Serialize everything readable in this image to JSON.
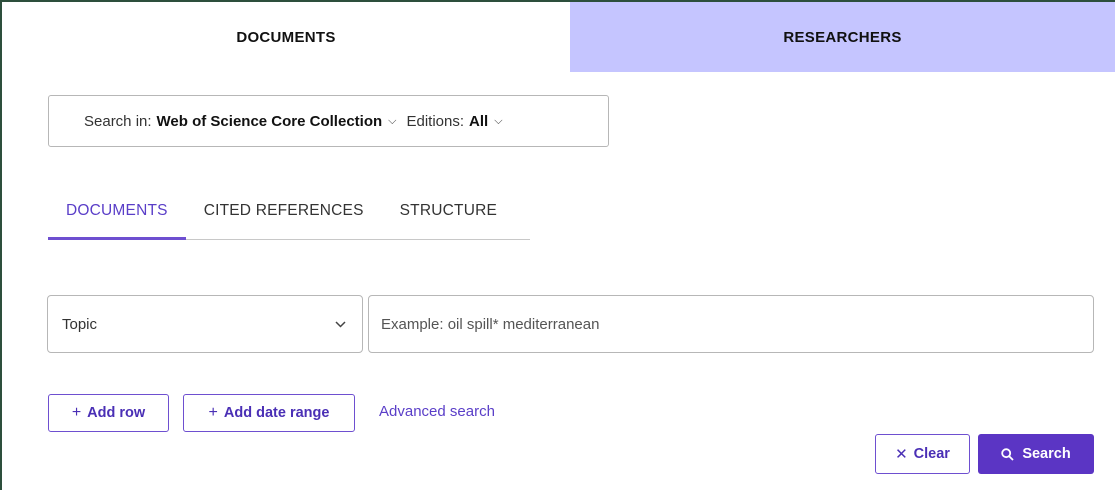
{
  "top_tabs": {
    "documents": "DOCUMENTS",
    "researchers": "RESEARCHERS"
  },
  "search_in": {
    "label": "Search in:",
    "collection": "Web of Science Core Collection",
    "editions_label": "Editions:",
    "editions_value": "All"
  },
  "sub_tabs": [
    "DOCUMENTS",
    "CITED REFERENCES",
    "STRUCTURE"
  ],
  "query_row": {
    "field": "Topic",
    "placeholder": "Example: oil spill* mediterranean",
    "value": ""
  },
  "actions": {
    "add_row": "Add row",
    "add_date_range": "Add date range",
    "advanced_search": "Advanced search",
    "clear": "Clear",
    "search": "Search"
  },
  "colors": {
    "accent": "#5b35c4",
    "researchers_tab_bg": "#c5c5ff",
    "frame_border": "#2d4f3c"
  },
  "icons": {
    "chevron": "chevron-down-icon",
    "plus": "plus-icon",
    "clear": "close-icon",
    "search": "search-icon"
  }
}
